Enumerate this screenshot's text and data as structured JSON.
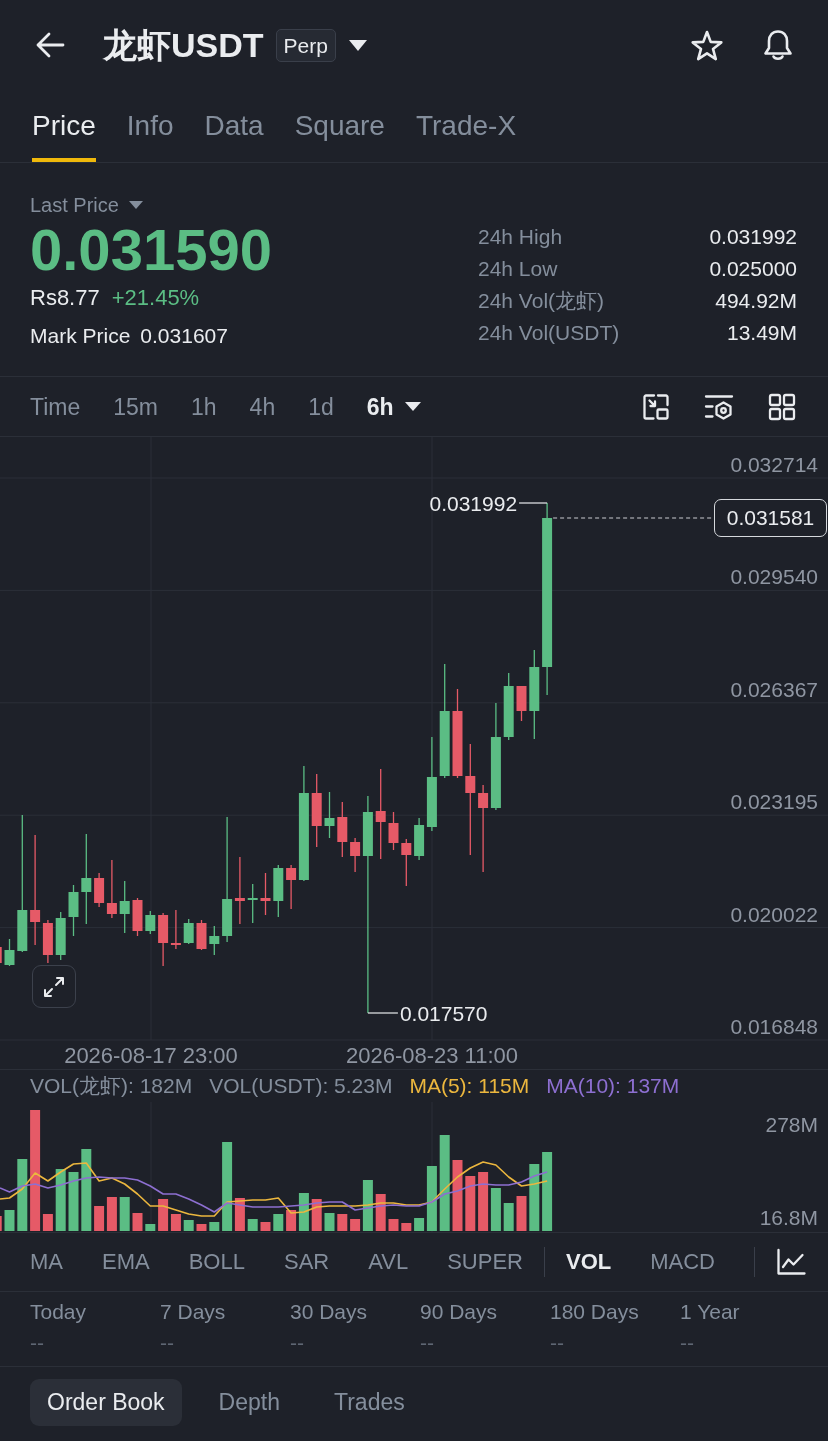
{
  "header": {
    "title": "龙虾USDT",
    "badge": "Perp"
  },
  "tabs": [
    {
      "label": "Price",
      "selected": true
    },
    {
      "label": "Info",
      "selected": false
    },
    {
      "label": "Data",
      "selected": false
    },
    {
      "label": "Square",
      "selected": false
    },
    {
      "label": "Trade-X",
      "selected": false
    }
  ],
  "price": {
    "label": "Last Price",
    "last": "0.031590",
    "fiat": "Rs8.77",
    "change": "+21.45%",
    "mark_label": "Mark Price",
    "mark": "0.031607"
  },
  "stats": [
    {
      "label": "24h High",
      "value": "0.031992"
    },
    {
      "label": "24h Low",
      "value": "0.025000"
    },
    {
      "label": "24h Vol(龙虾)",
      "value": "494.92M"
    },
    {
      "label": "24h Vol(USDT)",
      "value": "13.49M"
    }
  ],
  "intervals": [
    {
      "label": "Time",
      "kind": "option",
      "selected": false
    },
    {
      "label": "15m",
      "kind": "option",
      "selected": false
    },
    {
      "label": "1h",
      "kind": "option",
      "selected": false
    },
    {
      "label": "4h",
      "kind": "option",
      "selected": false
    },
    {
      "label": "1d",
      "kind": "option",
      "selected": false
    },
    {
      "label": "6h",
      "kind": "dropdown",
      "selected": true
    }
  ],
  "chart": {
    "y_labels": [
      "0.032714",
      "0.029540",
      "0.026367",
      "0.023195",
      "0.020022",
      "0.016848"
    ],
    "x_labels": [
      "2026-08-17 23:00",
      "2026-08-23 11:00"
    ],
    "high_label": "0.031992",
    "low_label": "0.017570",
    "price_tag": "0.031581"
  },
  "volume": {
    "legend": [
      {
        "text": "VOL(龙虾): 182M",
        "kind": "volume",
        "color": "#848e9c"
      },
      {
        "text": "VOL(USDT): 5.23M",
        "kind": "volume",
        "color": "#848e9c"
      },
      {
        "text": "MA(5): 115M",
        "kind": "ma",
        "color": "#ecb73e"
      },
      {
        "text": "MA(10): 137M",
        "kind": "ma",
        "color": "#8d6fd1"
      }
    ],
    "y_labels": [
      "278M",
      "16.8M"
    ]
  },
  "main_indicators": [
    {
      "label": "MA",
      "selected": false
    },
    {
      "label": "EMA",
      "selected": false
    },
    {
      "label": "BOLL",
      "selected": false
    },
    {
      "label": "SAR",
      "selected": false
    },
    {
      "label": "AVL",
      "selected": false
    },
    {
      "label": "SUPER",
      "selected": false
    }
  ],
  "sub_indicators": [
    {
      "label": "VOL",
      "selected": true
    },
    {
      "label": "MACD",
      "selected": false
    }
  ],
  "periods": [
    {
      "label": "Today",
      "value": "--"
    },
    {
      "label": "7 Days",
      "value": "--"
    },
    {
      "label": "30 Days",
      "value": "--"
    },
    {
      "label": "90 Days",
      "value": "--"
    },
    {
      "label": "180 Days",
      "value": "--"
    },
    {
      "label": "1 Year",
      "value": "--"
    }
  ],
  "bottom_tabs": [
    {
      "label": "Order Book",
      "selected": true
    },
    {
      "label": "Depth",
      "selected": false
    },
    {
      "label": "Trades",
      "selected": false
    }
  ]
}
